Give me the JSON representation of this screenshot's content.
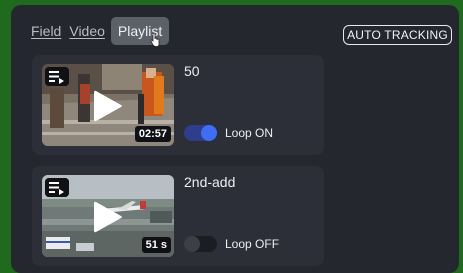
{
  "tabs": [
    {
      "label": "Field",
      "active": false
    },
    {
      "label": "Video",
      "active": false
    },
    {
      "label": "Playlist",
      "active": true
    }
  ],
  "auto_tracking_label": "AUTO TRACKING",
  "playlist": [
    {
      "title": "50",
      "duration": "02:57",
      "loop_label": "Loop ON",
      "loop_on": true,
      "thumbnail": "street-scene"
    },
    {
      "title": "2nd-add",
      "duration": "51 s",
      "loop_label": "Loop OFF",
      "loop_on": false,
      "thumbnail": "airport-scene"
    }
  ],
  "colors": {
    "background": "#1f6a1d",
    "panel": "#24272e",
    "card": "#2c2f37",
    "toggle_on": "#3f6ef2",
    "active_tab": "#5c6068"
  },
  "icons": [
    "playlist-icon",
    "play-icon",
    "hand-cursor-icon"
  ]
}
